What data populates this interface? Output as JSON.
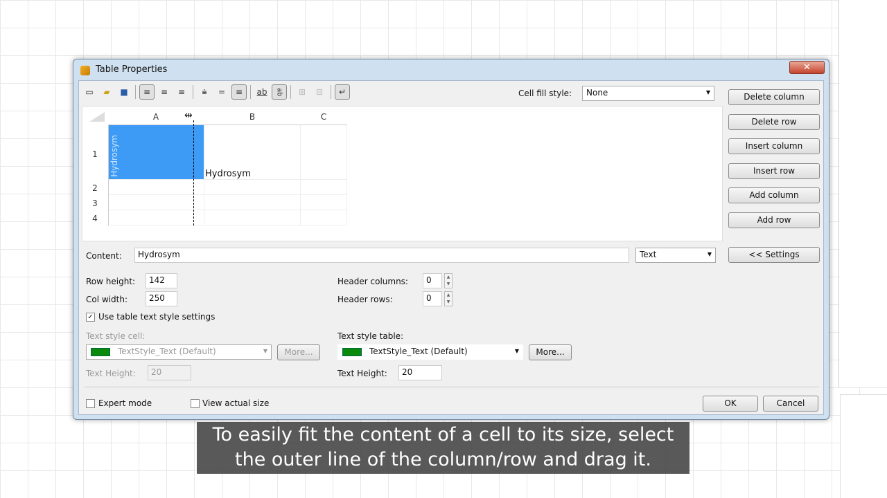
{
  "window": {
    "title": "Table Properties",
    "close": "✕"
  },
  "toolbar": {
    "icons": [
      "new-icon",
      "open-icon",
      "save-icon",
      "align-left-icon",
      "align-center-icon",
      "align-right-icon",
      "valign-top-icon",
      "valign-middle-icon",
      "valign-bottom-icon",
      "text-horizontal-icon",
      "text-vertical-icon",
      "merge-cells-icon",
      "split-cells-icon",
      "wrap-text-icon"
    ]
  },
  "cell_fill": {
    "label": "Cell fill style:",
    "value": "None"
  },
  "grid": {
    "columns": [
      "A",
      "B",
      "C"
    ],
    "rows": [
      "1",
      "2",
      "3",
      "4"
    ],
    "cell_a1": "Hydrosym",
    "cell_b1": "Hydrosym",
    "selected_color": "#3d9bf5"
  },
  "buttons": {
    "delete_column": "Delete column",
    "delete_row": "Delete row",
    "insert_column": "Insert column",
    "insert_row": "Insert row",
    "add_column": "Add column",
    "add_row": "Add row",
    "settings": "<< Settings",
    "ok": "OK",
    "cancel": "Cancel",
    "more_cell": "More...",
    "more_table": "More..."
  },
  "content": {
    "label": "Content:",
    "value": "Hydrosym",
    "type": "Text"
  },
  "row_height": {
    "label": "Row height:",
    "value": "142"
  },
  "col_width": {
    "label": "Col width:",
    "value": "250"
  },
  "header_columns": {
    "label": "Header columns:",
    "value": "0"
  },
  "header_rows": {
    "label": "Header rows:",
    "value": "0"
  },
  "use_table_style": {
    "label": "Use table text style settings",
    "checked": true
  },
  "text_style_cell": {
    "label": "Text style cell:",
    "value": "TextStyle_Text (Default)",
    "height_label": "Text Height:",
    "height": "20"
  },
  "text_style_table": {
    "label": "Text style table:",
    "value": "TextStyle_Text (Default)",
    "height_label": "Text Height:",
    "height": "20"
  },
  "expert_mode": {
    "label": "Expert mode",
    "checked": false
  },
  "view_actual": {
    "label": "View actual size",
    "checked": false
  },
  "subtitle": {
    "line1": "To easily fit the content of a cell to its size, select",
    "line2": "the outer line of the column/row and drag it."
  }
}
